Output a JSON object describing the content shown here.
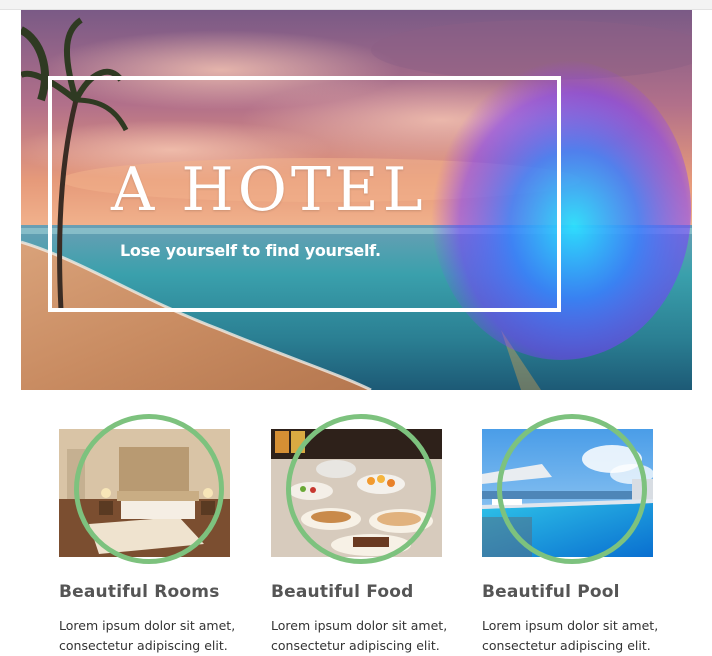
{
  "hero": {
    "title": "A HOTEL",
    "tagline": "Lose yourself to find yourself."
  },
  "cards": [
    {
      "title": "Beautiful Rooms",
      "text": "Lorem ipsum dolor sit amet, consectetur adipiscing elit."
    },
    {
      "title": "Beautiful Food",
      "text": "Lorem ipsum dolor sit amet, consectetur adipiscing elit."
    },
    {
      "title": "Beautiful Pool",
      "text": "Lorem ipsum dolor sit amet, consectetur adipiscing elit."
    }
  ],
  "colors": {
    "ring": "#7dc27e",
    "heading": "#555555",
    "body_text": "#333333"
  }
}
